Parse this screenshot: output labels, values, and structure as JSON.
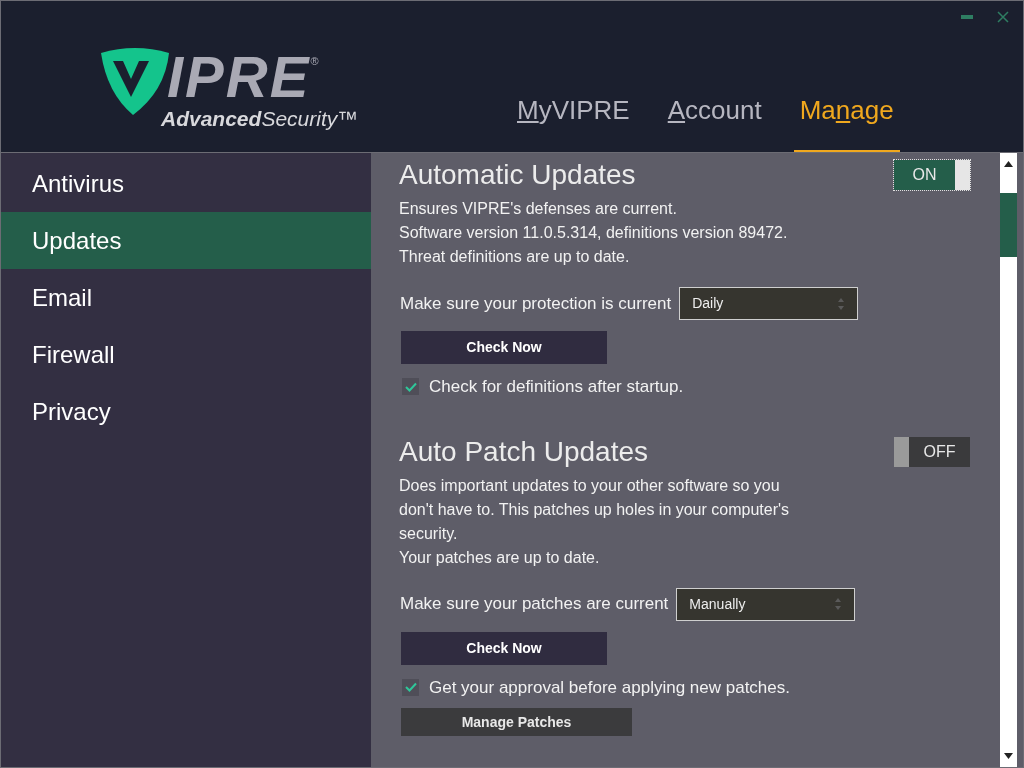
{
  "logo": {
    "wordmark": "IPRE",
    "registered": "®",
    "tagline": "**Advanced**Security™"
  },
  "nav": [
    {
      "key": "M",
      "after": "yVIPRE",
      "selected": false
    },
    {
      "key": "A",
      "after": "ccount",
      "selected": false
    },
    {
      "before": "Ma",
      "key": "n",
      "after": "age",
      "selected": true
    }
  ],
  "sidebar": {
    "items": [
      {
        "label": "Antivirus",
        "selected": false
      },
      {
        "label": "Updates",
        "selected": true
      },
      {
        "label": "Email",
        "selected": false
      },
      {
        "label": "Firewall",
        "selected": false
      },
      {
        "label": "Privacy",
        "selected": false
      }
    ]
  },
  "sections": [
    {
      "title": "Automatic Updates",
      "toggle": {
        "label": "ON",
        "on": true,
        "focused": true
      },
      "description": [
        "Ensures VIPRE's defenses are current.",
        "Software version 11.0.5.314, definitions version 89472.",
        "Threat definitions are up to date."
      ],
      "setting": {
        "label": "Make sure your protection is current",
        "value": "Daily"
      },
      "buttons": [
        {
          "label": "Check Now",
          "kind": "primary"
        }
      ],
      "checkbox": {
        "label": "Check for definitions after startup.",
        "checked": true
      }
    },
    {
      "title": "Auto Patch Updates",
      "toggle": {
        "label": "OFF",
        "on": false,
        "focused": false
      },
      "description": [
        "Does important updates to your other software so you don't have to. This patches up holes in your computer's security.",
        "Your patches are up to date."
      ],
      "setting": {
        "label": "Make sure your patches are current",
        "value": "Manually"
      },
      "buttons": [
        {
          "label": "Check Now",
          "kind": "primary"
        }
      ],
      "checkbox": {
        "label": "Get your approval before applying new patches.",
        "checked": true
      },
      "extra_buttons": [
        {
          "label": "Manage Patches",
          "kind": "secondary"
        }
      ]
    }
  ]
}
